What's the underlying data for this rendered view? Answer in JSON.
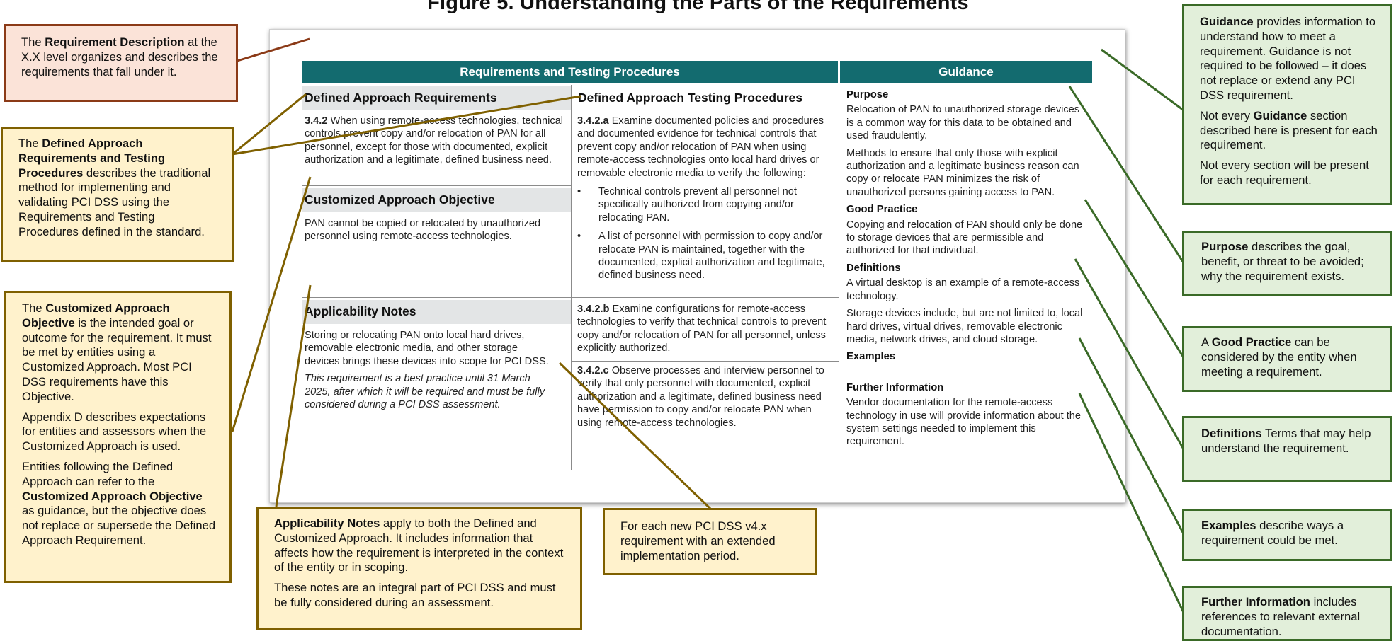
{
  "figure": {
    "title": "Figure 5. Understanding the Parts of the Requirements"
  },
  "table": {
    "header_req": "Requirements and Testing Procedures",
    "header_guidance": "Guidance",
    "defined_req_heading": "Defined Approach Requirements",
    "defined_tp_heading": "Defined Approach Testing Procedures",
    "req_id": "3.4.2",
    "req_text": " When using remote-access technologies, technical controls prevent copy and/or relocation of PAN for all personnel, except for those with documented, explicit authorization and a legitimate, defined business need.",
    "customized_heading": "Customized Approach Objective",
    "customized_text": "PAN cannot be copied or relocated by unauthorized personnel using remote-access technologies.",
    "applicability_heading": "Applicability Notes",
    "applicability_text": "Storing or relocating PAN onto local hard drives, removable electronic media, and other storage devices brings these devices into scope for PCI DSS.",
    "applicability_italic": "This requirement is a best practice until 31 March 2025, after which it will be required and must be fully considered during a PCI DSS assessment.",
    "tp_a_id": "3.4.2.a",
    "tp_a_text": " Examine documented policies and procedures and documented evidence for technical controls that prevent copy and/or relocation of PAN when using remote-access technologies onto local hard drives or removable electronic media to verify the following:",
    "tp_a_bullets": [
      "Technical controls prevent all personnel not specifically authorized from copying and/or relocating PAN.",
      "A list of personnel with permission to copy and/or relocate PAN is maintained, together with the documented, explicit authorization and legitimate, defined business need."
    ],
    "tp_b_id": "3.4.2.b",
    "tp_b_text": " Examine configurations for remote-access technologies to verify that technical controls to prevent copy and/or relocation of PAN for all personnel, unless explicitly authorized.",
    "tp_c_id": "3.4.2.c",
    "tp_c_text": " Observe processes and interview personnel to verify that only personnel with documented, explicit authorization and a legitimate, defined business need have permission to copy and/or relocate PAN when using remote-access technologies."
  },
  "guidance": {
    "purpose_heading": "Purpose",
    "purpose_p1": "Relocation of PAN to unauthorized storage devices is a common way for this data to be obtained and used fraudulently.",
    "purpose_p2": "Methods to ensure that only those with explicit authorization and a legitimate business reason can copy or relocate PAN minimizes the risk of unauthorized persons gaining access to PAN.",
    "good_practice_heading": "Good Practice",
    "good_practice_text": "Copying and relocation of PAN should only be done to storage devices that are permissible and authorized for that individual.",
    "definitions_heading": "Definitions",
    "definitions_p1": "A virtual desktop is an example of a remote-access technology.",
    "definitions_p2": "Storage devices include, but are not limited to, local hard drives, virtual drives, removable electronic media, network drives, and cloud storage.",
    "examples_heading": "Examples",
    "further_heading": "Further Information",
    "further_text": "Vendor documentation for the remote-access technology in use will provide information about the system settings needed to implement this requirement."
  },
  "callouts": {
    "req_desc": {
      "pre": "The ",
      "bold": "Requirement Description",
      "post": " at the X.X level organizes and describes the requirements that fall under it."
    },
    "defined": {
      "pre": "The ",
      "bold": "Defined Approach Requirements and Testing Procedures",
      "post": " describes the traditional method for implementing and validating PCI DSS using the Requirements and Testing Procedures defined in the standard."
    },
    "customized": {
      "p1_pre": "The ",
      "p1_bold": "Customized Approach Objective",
      "p1_post": " is the intended goal or outcome for the requirement. It must be met by entities using a Customized Approach. Most PCI DSS requirements have this Objective.",
      "p2": "Appendix D describes expectations for entities and assessors when the Customized Approach is used.",
      "p3_pre": "Entities following the Defined Approach can refer to the ",
      "p3_bold": "Customized Approach Objective",
      "p3_post": " as guidance, but the objective does not replace or supersede the Defined Approach Requirement."
    },
    "applicability": {
      "p1_bold": "Applicability Notes",
      "p1_post": " apply to both the Defined and Customized Approach. It includes information that affects how the requirement is interpreted in the context of the entity or in scoping.",
      "p2": "These notes are an integral part of PCI DSS and must be fully considered during an assessment."
    },
    "extended": {
      "text": "For each new PCI DSS v4.x requirement with an extended implementation period."
    },
    "guidance": {
      "p1_bold": "Guidance",
      "p1_post": " provides information to understand how to meet a requirement. Guidance is not required to be followed – it does not replace or extend any PCI DSS requirement.",
      "p2_pre": "Not every ",
      "p2_bold": "Guidance",
      "p2_post": " section described here is present for each requirement.",
      "p3": "Not every section will be present for each requirement."
    },
    "purpose": {
      "bold": "Purpose",
      "post": " describes the goal, benefit, or threat to be avoided; why the requirement exists."
    },
    "good_practice": {
      "pre": "A ",
      "bold": "Good Practice",
      "post": " can be considered by the entity when meeting a requirement."
    },
    "definitions": {
      "bold": "Definitions",
      "post": " Terms that may help understand the requirement."
    },
    "examples": {
      "bold": "Examples",
      "post": " describe ways a requirement could be met."
    },
    "further": {
      "bold": "Further Information",
      "post": " includes references to relevant external documentation."
    }
  },
  "colors": {
    "header_teal": "#136b6f",
    "pink_fill": "#fbe3d8",
    "pink_border": "#8b3a17",
    "yellow_fill": "#fff2cc",
    "yellow_border": "#7f6000",
    "green_fill": "#e2efda",
    "green_border": "#3a6a27"
  }
}
